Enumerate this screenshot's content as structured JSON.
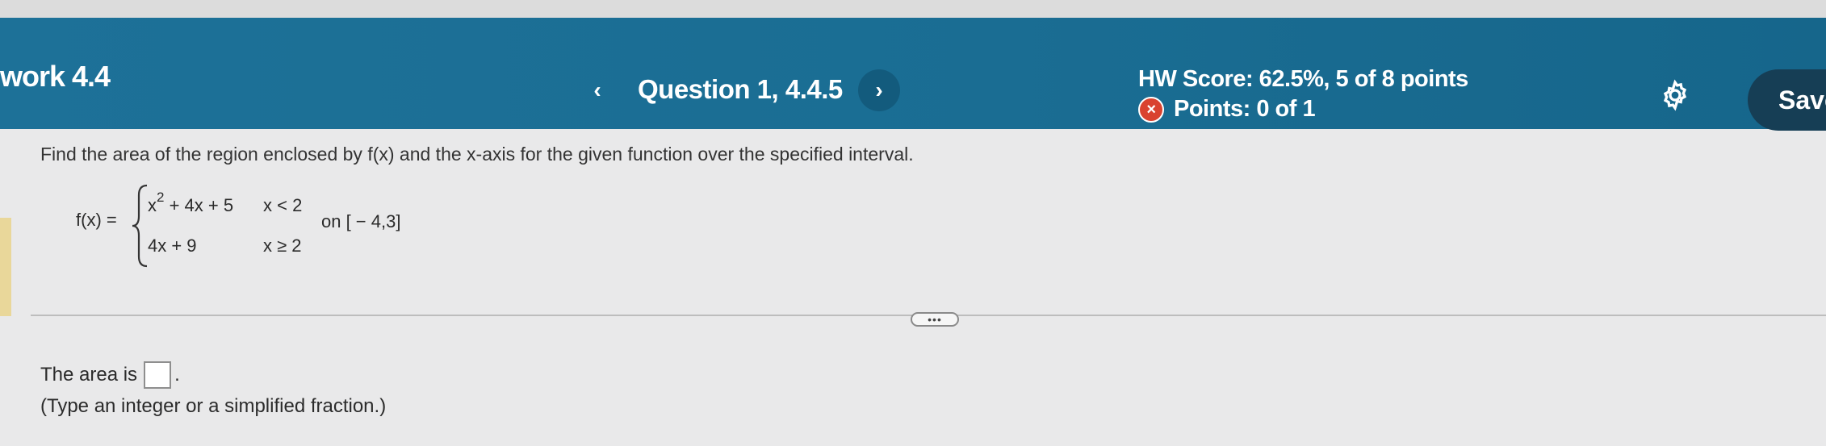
{
  "header": {
    "assignment_title": "work 4.4",
    "question_title": "Question 1, 4.4.5",
    "prev_icon": "‹",
    "next_icon": "›",
    "hw_score": "HW Score: 62.5%, 5 of 8 points",
    "points": "Points: 0 of 1",
    "points_status_icon": "×",
    "settings_icon": "gear-icon",
    "save_label": "Save"
  },
  "question": {
    "prompt": "Find the area of the region enclosed by f(x) and the x-axis for the given function over the specified interval.",
    "function_label": "f(x) =",
    "piece1_expr_base": "x",
    "piece1_expr_exp": "2",
    "piece1_expr_rest": " + 4x + 5",
    "piece1_condition": "x < 2",
    "piece2_expr": "4x + 9",
    "piece2_condition": "x ≥ 2",
    "interval": "on [ − 4,3]"
  },
  "divider": {
    "more_label": "•••"
  },
  "answer": {
    "prefix": "The area is",
    "suffix": ".",
    "hint": "(Type an integer or a simplified fraction.)"
  },
  "colors": {
    "header_bg": "#1a6d93",
    "save_bg": "#163e55",
    "incorrect_icon": "#d9422f"
  }
}
